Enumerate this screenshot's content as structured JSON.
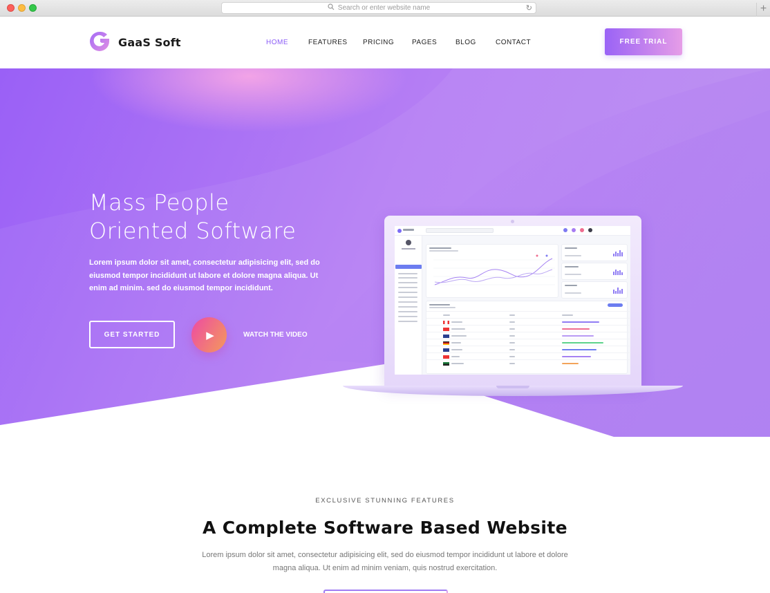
{
  "browser": {
    "address_placeholder": "Search or enter website name"
  },
  "brand": {
    "name": "GaaS Soft",
    "accent": "#8b5cf6"
  },
  "nav": {
    "items": [
      "HOME",
      "FEATURES",
      "PRICING",
      "PAGES",
      "BLOG",
      "CONTACT"
    ],
    "active": "HOME",
    "cta": "FREE TRIAL"
  },
  "hero": {
    "title_line1": "Mass People",
    "title_line2": "Oriented Software",
    "text": "Lorem ipsum dolor sit amet, consectetur adipisicing elit, sed do eiusmod tempor incididunt ut labore et dolore magna aliqua. Ut enim ad minim. sed do eiusmod tempor incididunt.",
    "primary_button": "GET STARTED",
    "video_label": "WATCH THE VIDEO",
    "colors": {
      "start": "#9b63f7",
      "end": "#b982f3",
      "glow": "#f0a2e8"
    }
  },
  "features": {
    "eyebrow": "EXCLUSIVE STUNNING FEATURES",
    "title": "A Complete Software Based Website",
    "text": "Lorem ipsum dolor sit amet, consectetur adipisicing elit, sed do eiusmod tempor incididunt ut labore et dolore magna aliqua. Ut enim ad minim veniam, quis nostrud exercitation."
  }
}
